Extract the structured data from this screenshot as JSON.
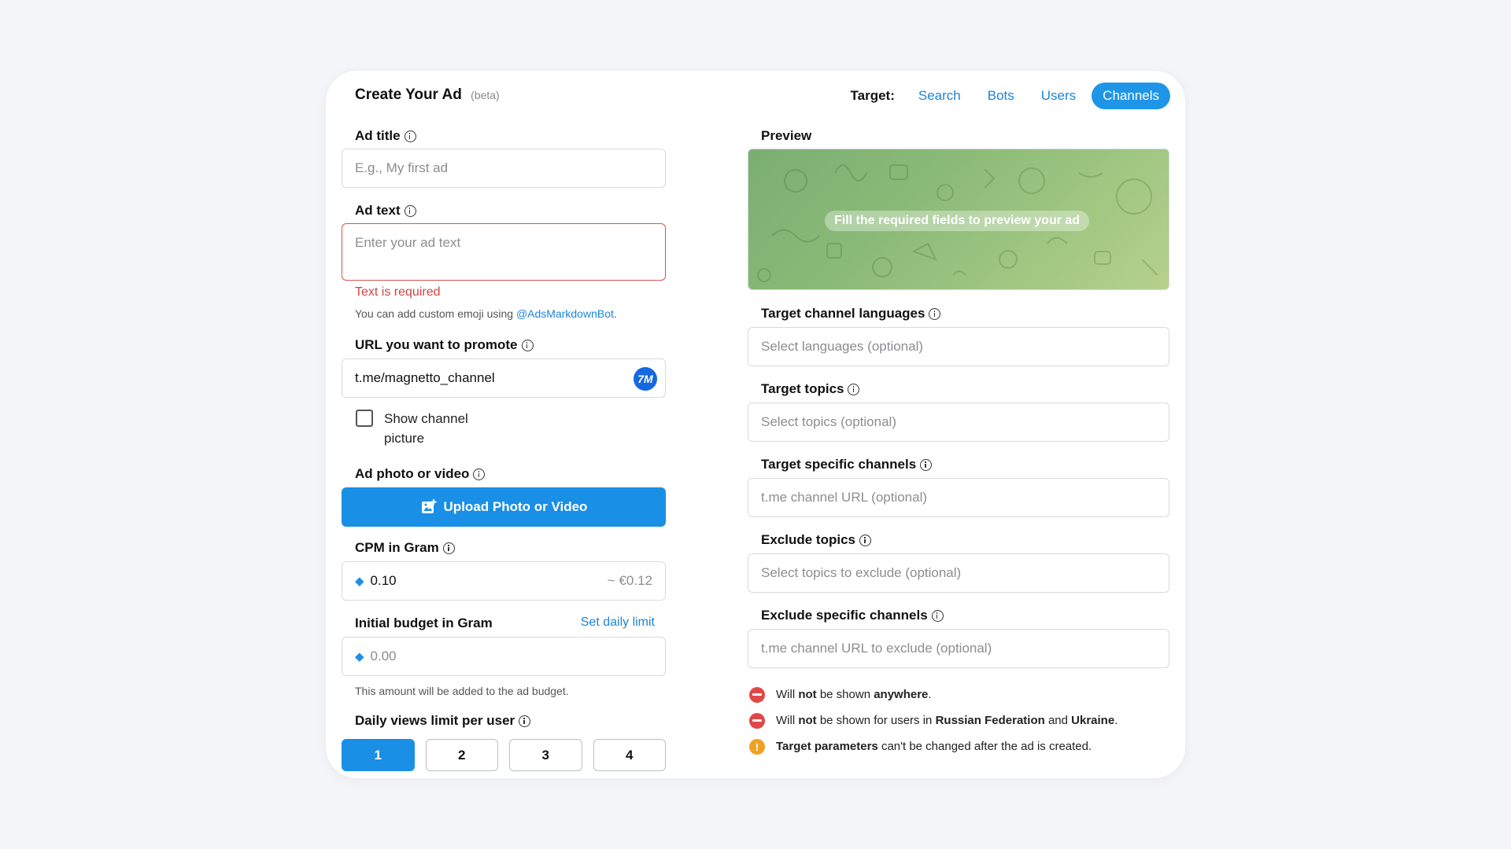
{
  "header": {
    "title": "Create Your Ad",
    "beta": "(beta)",
    "target_label": "Target:",
    "tabs": [
      {
        "label": "Search",
        "active": false
      },
      {
        "label": "Bots",
        "active": false
      },
      {
        "label": "Users",
        "active": false
      },
      {
        "label": "Channels",
        "active": true
      }
    ]
  },
  "form": {
    "ad_title": {
      "label": "Ad title",
      "placeholder": "E.g., My first ad"
    },
    "ad_text": {
      "label": "Ad text",
      "placeholder": "Enter your ad text",
      "error": "Text is required",
      "hint_prefix": "You can add custom emoji using ",
      "hint_link": "@AdsMarkdownBot",
      "hint_suffix": "."
    },
    "url": {
      "label": "URL you want to promote",
      "value": "t.me/magnetto_channel",
      "bot_badge": "7M"
    },
    "show_picture": {
      "label": "Show channel picture",
      "checked": false
    },
    "media": {
      "label": "Ad photo or video",
      "button": "Upload Photo or Video"
    },
    "cpm": {
      "label": "CPM in Gram",
      "value": "0.10",
      "equivalent": "~ €0.12"
    },
    "budget": {
      "label": "Initial budget in Gram",
      "daily_limit_link": "Set daily limit",
      "placeholder": "0.00",
      "hint": "This amount will be added to the ad budget."
    },
    "views_limit": {
      "label": "Daily views limit per user",
      "options": [
        "1",
        "2",
        "3",
        "4"
      ],
      "selected": "1"
    }
  },
  "right": {
    "preview": {
      "label": "Preview",
      "message": "Fill the required fields to preview your ad"
    },
    "languages": {
      "label": "Target channel languages",
      "placeholder": "Select languages (optional)"
    },
    "topics": {
      "label": "Target topics",
      "placeholder": "Select topics (optional)"
    },
    "channels": {
      "label": "Target specific channels",
      "placeholder": "t.me channel URL (optional)"
    },
    "exclude_topics": {
      "label": "Exclude topics",
      "placeholder": "Select topics to exclude (optional)"
    },
    "exclude_channels": {
      "label": "Exclude specific channels",
      "placeholder": "t.me channel URL to exclude (optional)"
    },
    "notes": [
      {
        "type": "error",
        "parts": [
          "Will ",
          "not",
          " be shown ",
          "anywhere",
          "."
        ]
      },
      {
        "type": "error",
        "parts": [
          "Will ",
          "not",
          " be shown for users in ",
          "Russian Federation",
          " and ",
          "Ukraine",
          "."
        ]
      },
      {
        "type": "warning",
        "parts": [
          "",
          "Target parameters",
          " can't be changed after the ad is created."
        ]
      }
    ]
  },
  "colors": {
    "accent": "#1a8fe6",
    "error": "#d14343",
    "warning": "#f0a024"
  }
}
